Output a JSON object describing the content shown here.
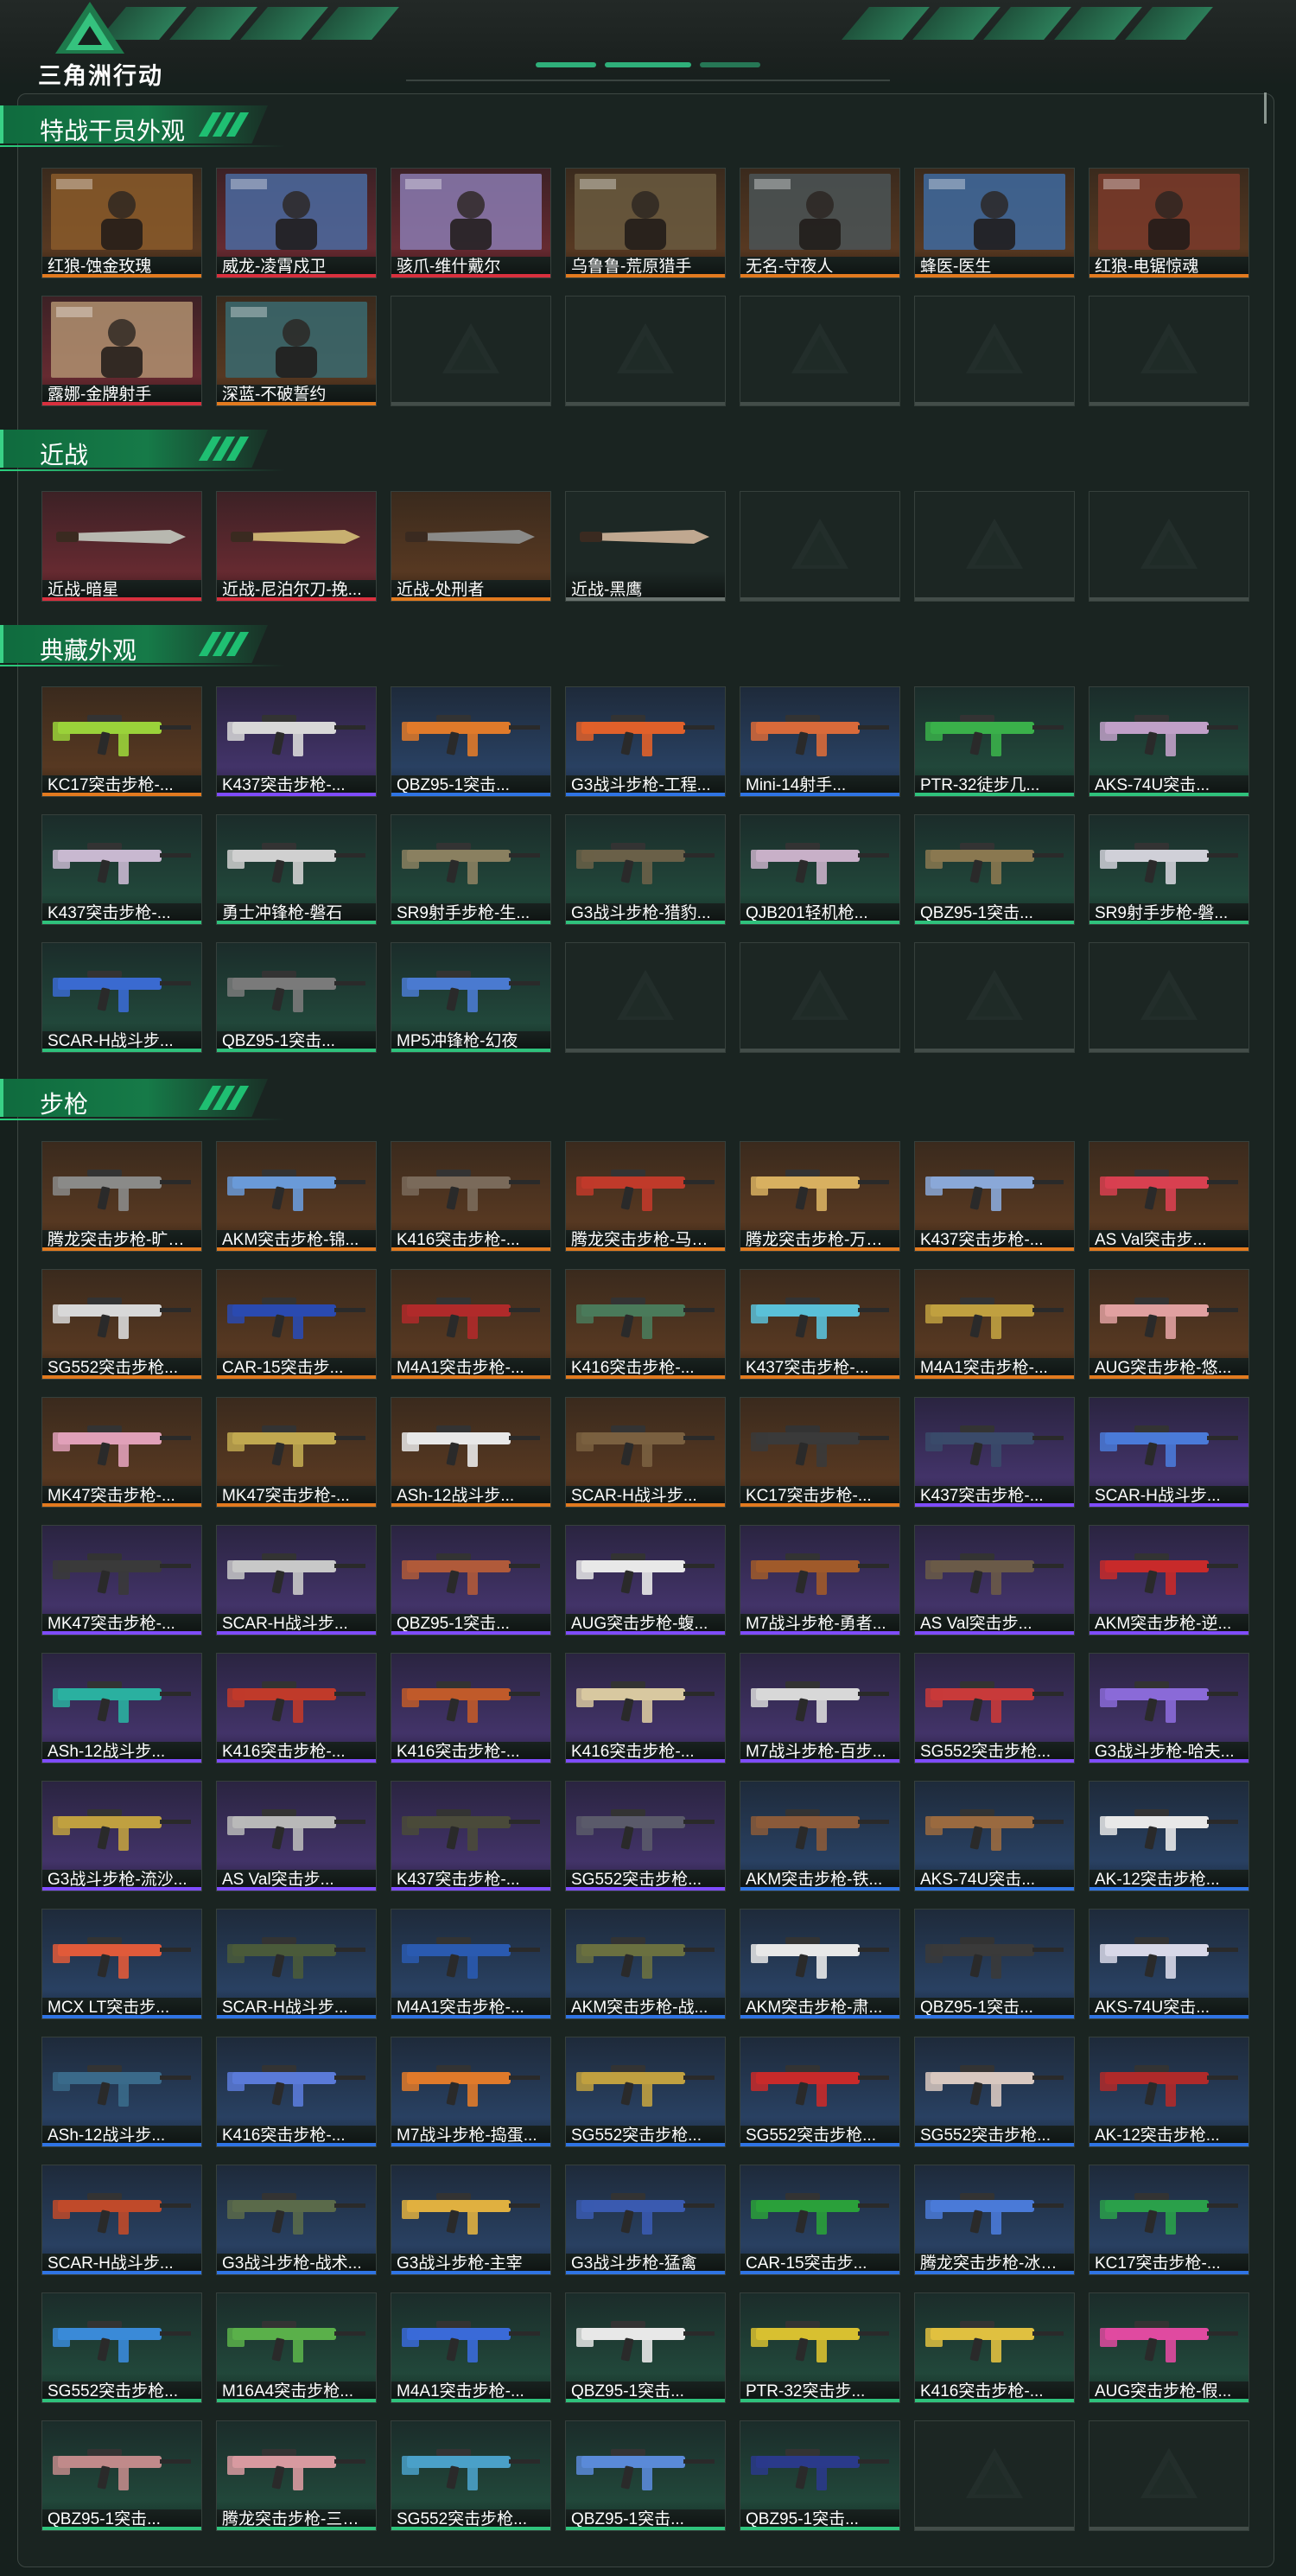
{
  "app": {
    "logo_text": "三角洲行动"
  },
  "colors": {
    "accent": "#2fc27c",
    "gold": "#e27a1f",
    "red": "#d8303e",
    "purple": "#7f4cff",
    "blue": "#2f74e4",
    "green": "#2fc27c"
  },
  "sections": [
    {
      "title": "特战干员外观",
      "items": [
        {
          "name": "红狼-蚀金玫瑰",
          "quality": "orange",
          "kind": "operator",
          "tone": "#8a5a2a"
        },
        {
          "name": "威龙-凌霄戍卫",
          "quality": "red",
          "kind": "operator",
          "tone": "#4a6aa0"
        },
        {
          "name": "骇爪-维什戴尔",
          "quality": "red",
          "kind": "operator",
          "tone": "#8a7ab0"
        },
        {
          "name": "乌鲁鲁-荒原猎手",
          "quality": "orange",
          "kind": "operator",
          "tone": "#6a5a40"
        },
        {
          "name": "无名-守夜人",
          "quality": "orange",
          "kind": "operator",
          "tone": "#4a5456"
        },
        {
          "name": "蜂医-医生",
          "quality": "orange",
          "kind": "operator",
          "tone": "#3e6aa0"
        },
        {
          "name": "红狼-电锯惊魂",
          "quality": "orange",
          "kind": "operator",
          "tone": "#7a3a2a"
        },
        {
          "name": "露娜-金牌射手",
          "quality": "red",
          "kind": "operator",
          "tone": "#b09070"
        },
        {
          "name": "深蓝-不破誓约",
          "quality": "orange",
          "kind": "operator",
          "tone": "#3a6a70"
        },
        {
          "empty": true
        },
        {
          "empty": true
        },
        {
          "empty": true
        },
        {
          "empty": true
        },
        {
          "empty": true
        }
      ]
    },
    {
      "title": "近战",
      "items": [
        {
          "name": "近战-暗星",
          "quality": "red",
          "kind": "melee",
          "tone": "#b8b8b0"
        },
        {
          "name": "近战-尼泊尔刀-挽...",
          "quality": "red",
          "kind": "melee",
          "tone": "#c8b070"
        },
        {
          "name": "近战-处刑者",
          "quality": "orange",
          "kind": "melee",
          "tone": "#8a8a88"
        },
        {
          "name": "近战-黑鹰",
          "quality": "gray",
          "kind": "melee",
          "tone": "#c0a890"
        },
        {
          "empty": true
        },
        {
          "empty": true
        },
        {
          "empty": true
        }
      ]
    },
    {
      "title": "典藏外观",
      "items": [
        {
          "name": "KC17突击步枪-...",
          "quality": "orange",
          "kind": "gun",
          "tone": "#9ad23a"
        },
        {
          "name": "K437突击步枪-...",
          "quality": "purple",
          "kind": "gun",
          "tone": "#d8d8d8"
        },
        {
          "name": "QBZ95-1突击...",
          "quality": "blue",
          "kind": "gun",
          "tone": "#e07a2a"
        },
        {
          "name": "G3战斗步枪-工程...",
          "quality": "blue",
          "kind": "gun",
          "tone": "#e0602a"
        },
        {
          "name": "Mini-14射手...",
          "quality": "blue",
          "kind": "gun",
          "tone": "#d86a3a"
        },
        {
          "name": "PTR-32徒步几...",
          "quality": "green",
          "kind": "gun",
          "tone": "#3ab04a"
        },
        {
          "name": "AKS-74U突击...",
          "quality": "green",
          "kind": "gun",
          "tone": "#c0a0c8"
        },
        {
          "name": "K437突击步枪-...",
          "quality": "green",
          "kind": "gun",
          "tone": "#c8b8d0"
        },
        {
          "name": "勇士冲锋枪-磐石",
          "quality": "green",
          "kind": "gun",
          "tone": "#d0d0d0"
        },
        {
          "name": "SR9射手步枪-生...",
          "quality": "green",
          "kind": "gun",
          "tone": "#8a8060"
        },
        {
          "name": "G3战斗步枪-猎豹...",
          "quality": "green",
          "kind": "gun",
          "tone": "#6a6048"
        },
        {
          "name": "QJB201轻机枪...",
          "quality": "green",
          "kind": "gun",
          "tone": "#c8b0c8"
        },
        {
          "name": "QBZ95-1突击...",
          "quality": "green",
          "kind": "gun",
          "tone": "#8a7850"
        },
        {
          "name": "SR9射手步枪-磐...",
          "quality": "green",
          "kind": "gun",
          "tone": "#d0d0d8"
        },
        {
          "name": "SCAR-H战斗步...",
          "quality": "green",
          "kind": "gun",
          "tone": "#3a6ad0"
        },
        {
          "name": "QBZ95-1突击...",
          "quality": "green",
          "kind": "gun",
          "tone": "#7a7a7a"
        },
        {
          "name": "MP5冲锋枪-幻夜",
          "quality": "green",
          "kind": "gun",
          "tone": "#4a7ad0"
        },
        {
          "empty": true
        },
        {
          "empty": true
        },
        {
          "empty": true
        },
        {
          "empty": true
        }
      ]
    },
    {
      "title": "步枪",
      "items": [
        {
          "name": "腾龙突击步枪-旷野...",
          "quality": "orange",
          "kind": "gun",
          "tone": "#8a8a88"
        },
        {
          "name": "AKM突击步枪-锦...",
          "quality": "orange",
          "kind": "gun",
          "tone": "#6a9ad8"
        },
        {
          "name": "K416突击步枪-...",
          "quality": "orange",
          "kind": "gun",
          "tone": "#7a6a5a"
        },
        {
          "name": "腾龙突击步枪-马年...",
          "quality": "orange",
          "kind": "gun",
          "tone": "#c03a2a"
        },
        {
          "name": "腾龙突击步枪-万金...",
          "quality": "orange",
          "kind": "gun",
          "tone": "#d8b060"
        },
        {
          "name": "K437突击步枪-...",
          "quality": "orange",
          "kind": "gun",
          "tone": "#8aa8d8"
        },
        {
          "name": "AS Val突击步...",
          "quality": "orange",
          "kind": "gun",
          "tone": "#d84050"
        },
        {
          "name": "SG552突击步枪...",
          "quality": "orange",
          "kind": "gun",
          "tone": "#d8d8d8"
        },
        {
          "name": "CAR-15突击步...",
          "quality": "orange",
          "kind": "gun",
          "tone": "#2a4ab0"
        },
        {
          "name": "M4A1突击步枪-...",
          "quality": "orange",
          "kind": "gun",
          "tone": "#b02a2a"
        },
        {
          "name": "K416突击步枪-...",
          "quality": "orange",
          "kind": "gun",
          "tone": "#4a7a5a"
        },
        {
          "name": "K437突击步枪-...",
          "quality": "orange",
          "kind": "gun",
          "tone": "#5ac0d8"
        },
        {
          "name": "M4A1突击步枪-...",
          "quality": "orange",
          "kind": "gun",
          "tone": "#c0a040"
        },
        {
          "name": "AUG突击步枪-悠...",
          "quality": "orange",
          "kind": "gun",
          "tone": "#e0a0a0"
        },
        {
          "name": "MK47突击步枪-...",
          "quality": "orange",
          "kind": "gun",
          "tone": "#e0a0b8"
        },
        {
          "name": "MK47突击步枪-...",
          "quality": "orange",
          "kind": "gun",
          "tone": "#c0a850"
        },
        {
          "name": "ASh-12战斗步...",
          "quality": "orange",
          "kind": "gun",
          "tone": "#e8e8e8"
        },
        {
          "name": "SCAR-H战斗步...",
          "quality": "orange",
          "kind": "gun",
          "tone": "#7a6040"
        },
        {
          "name": "KC17突击步枪-...",
          "quality": "orange",
          "kind": "gun",
          "tone": "#3a3a3a"
        },
        {
          "name": "K437突击步枪-...",
          "quality": "purple",
          "kind": "gun",
          "tone": "#3a4a6a"
        },
        {
          "name": "SCAR-H战斗步...",
          "quality": "purple",
          "kind": "gun",
          "tone": "#4a7ad8"
        },
        {
          "name": "MK47突击步枪-...",
          "quality": "purple",
          "kind": "gun",
          "tone": "#3a3a3a"
        },
        {
          "name": "SCAR-H战斗步...",
          "quality": "purple",
          "kind": "gun",
          "tone": "#c8c8c8"
        },
        {
          "name": "QBZ95-1突击...",
          "quality": "purple",
          "kind": "gun",
          "tone": "#b05a3a"
        },
        {
          "name": "AUG突击步枪-蝮...",
          "quality": "purple",
          "kind": "gun",
          "tone": "#e8e8e8"
        },
        {
          "name": "M7战斗步枪-勇者...",
          "quality": "purple",
          "kind": "gun",
          "tone": "#a05a2a"
        },
        {
          "name": "AS Val突击步...",
          "quality": "purple",
          "kind": "gun",
          "tone": "#6a5a48"
        },
        {
          "name": "AKM突击步枪-逆...",
          "quality": "purple",
          "kind": "gun",
          "tone": "#c82a2a"
        },
        {
          "name": "ASh-12战斗步...",
          "quality": "purple",
          "kind": "gun",
          "tone": "#2ab0a0"
        },
        {
          "name": "K416突击步枪-...",
          "quality": "purple",
          "kind": "gun",
          "tone": "#c03a2a"
        },
        {
          "name": "K416突击步枪-...",
          "quality": "purple",
          "kind": "gun",
          "tone": "#c05a2a"
        },
        {
          "name": "K416突击步枪-...",
          "quality": "purple",
          "kind": "gun",
          "tone": "#d8c8a0"
        },
        {
          "name": "M7战斗步枪-百步...",
          "quality": "purple",
          "kind": "gun",
          "tone": "#d8d8d8"
        },
        {
          "name": "SG552突击步枪...",
          "quality": "purple",
          "kind": "gun",
          "tone": "#c83a3a"
        },
        {
          "name": "G3战斗步枪-哈夫...",
          "quality": "purple",
          "kind": "gun",
          "tone": "#8a6ad8"
        },
        {
          "name": "G3战斗步枪-流沙...",
          "quality": "purple",
          "kind": "gun",
          "tone": "#c0a040"
        },
        {
          "name": "AS Val突击步...",
          "quality": "purple",
          "kind": "gun",
          "tone": "#b8b8b8"
        },
        {
          "name": "K437突击步枪-...",
          "quality": "purple",
          "kind": "gun",
          "tone": "#4a4a3a"
        },
        {
          "name": "SG552突击步枪...",
          "quality": "purple",
          "kind": "gun",
          "tone": "#5a5a6a"
        },
        {
          "name": "AKM突击步枪-铁...",
          "quality": "blue",
          "kind": "gun",
          "tone": "#8a5a3a"
        },
        {
          "name": "AKS-74U突击...",
          "quality": "blue",
          "kind": "gun",
          "tone": "#9a6a40"
        },
        {
          "name": "AK-12突击步枪...",
          "quality": "blue",
          "kind": "gun",
          "tone": "#e8e8e8"
        },
        {
          "name": "MCX LT突击步...",
          "quality": "blue",
          "kind": "gun",
          "tone": "#e05a3a"
        },
        {
          "name": "SCAR-H战斗步...",
          "quality": "blue",
          "kind": "gun",
          "tone": "#4a5a3a"
        },
        {
          "name": "M4A1突击步枪-...",
          "quality": "blue",
          "kind": "gun",
          "tone": "#2a5ab0"
        },
        {
          "name": "AKM突击步枪-战...",
          "quality": "blue",
          "kind": "gun",
          "tone": "#6a7040"
        },
        {
          "name": "AKM突击步枪-肃...",
          "quality": "blue",
          "kind": "gun",
          "tone": "#e8e8e8"
        },
        {
          "name": "QBZ95-1突击...",
          "quality": "blue",
          "kind": "gun",
          "tone": "#3a3a3a"
        },
        {
          "name": "AKS-74U突击...",
          "quality": "blue",
          "kind": "gun",
          "tone": "#d8d8e8"
        },
        {
          "name": "ASh-12战斗步...",
          "quality": "blue",
          "kind": "gun",
          "tone": "#3a6a8a"
        },
        {
          "name": "K416突击步枪-...",
          "quality": "blue",
          "kind": "gun",
          "tone": "#5a7ad8"
        },
        {
          "name": "M7战斗步枪-捣蛋...",
          "quality": "blue",
          "kind": "gun",
          "tone": "#e07a2a"
        },
        {
          "name": "SG552突击步枪...",
          "quality": "blue",
          "kind": "gun",
          "tone": "#c0a040"
        },
        {
          "name": "SG552突击步枪...",
          "quality": "blue",
          "kind": "gun",
          "tone": "#c82a2a"
        },
        {
          "name": "SG552突击步枪...",
          "quality": "blue",
          "kind": "gun",
          "tone": "#d8c8c0"
        },
        {
          "name": "AK-12突击步枪...",
          "quality": "blue",
          "kind": "gun",
          "tone": "#b02a2a"
        },
        {
          "name": "SCAR-H战斗步...",
          "quality": "blue",
          "kind": "gun",
          "tone": "#c04a2a"
        },
        {
          "name": "G3战斗步枪-战术...",
          "quality": "blue",
          "kind": "gun",
          "tone": "#5a6a4a"
        },
        {
          "name": "G3战斗步枪-主宰",
          "quality": "blue",
          "kind": "gun",
          "tone": "#e0b040"
        },
        {
          "name": "G3战斗步枪-猛禽",
          "quality": "blue",
          "kind": "gun",
          "tone": "#3a5ab0"
        },
        {
          "name": "CAR-15突击步...",
          "quality": "blue",
          "kind": "gun",
          "tone": "#2aa03a"
        },
        {
          "name": "腾龙突击步枪-冰天...",
          "quality": "blue",
          "kind": "gun",
          "tone": "#4a7ad8"
        },
        {
          "name": "KC17突击步枪-...",
          "quality": "blue",
          "kind": "gun",
          "tone": "#2aa04a"
        },
        {
          "name": "SG552突击步枪...",
          "quality": "green",
          "kind": "gun",
          "tone": "#3a8ad8"
        },
        {
          "name": "M16A4突击步枪...",
          "quality": "green",
          "kind": "gun",
          "tone": "#5ab04a"
        },
        {
          "name": "M4A1突击步枪-...",
          "quality": "green",
          "kind": "gun",
          "tone": "#3a6ad8"
        },
        {
          "name": "QBZ95-1突击...",
          "quality": "green",
          "kind": "gun",
          "tone": "#e8e8e8"
        },
        {
          "name": "PTR-32突击步...",
          "quality": "green",
          "kind": "gun",
          "tone": "#d8c030"
        },
        {
          "name": "K416突击步枪-...",
          "quality": "green",
          "kind": "gun",
          "tone": "#e0c040"
        },
        {
          "name": "AUG突击步枪-假...",
          "quality": "green",
          "kind": "gun",
          "tone": "#e04aa0"
        },
        {
          "name": "QBZ95-1突击...",
          "quality": "green",
          "kind": "gun",
          "tone": "#c08a8a"
        },
        {
          "name": "腾龙突击步枪-三角...",
          "quality": "green",
          "kind": "gun",
          "tone": "#d89aa0"
        },
        {
          "name": "SG552突击步枪...",
          "quality": "green",
          "kind": "gun",
          "tone": "#4aa0c8"
        },
        {
          "name": "QBZ95-1突击...",
          "quality": "green",
          "kind": "gun",
          "tone": "#5a8ad8"
        },
        {
          "name": "QBZ95-1突击...",
          "quality": "green",
          "kind": "gun",
          "tone": "#2a3a8a"
        },
        {
          "empty": true
        },
        {
          "empty": true
        }
      ]
    }
  ]
}
